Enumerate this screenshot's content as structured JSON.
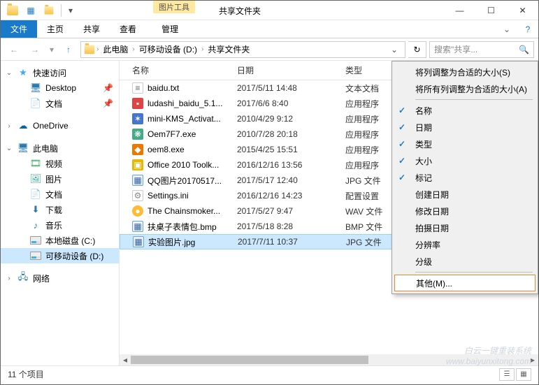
{
  "window": {
    "tool_context": "图片工具",
    "title": "共享文件夹",
    "min": "—",
    "max": "☐",
    "close": "✕"
  },
  "ribbon": {
    "file": "文件",
    "home": "主页",
    "share": "共享",
    "view": "查看",
    "manage": "管理"
  },
  "address": {
    "seg1": "此电脑",
    "seg2": "可移动设备 (D:)",
    "seg3": "共享文件夹",
    "search_placeholder": "搜索\"共享..."
  },
  "nav": {
    "quick": "快速访问",
    "desktop": "Desktop",
    "docs": "文档",
    "onedrive": "OneDrive",
    "thispc": "此电脑",
    "video": "视频",
    "pictures": "图片",
    "documents": "文档",
    "downloads": "下载",
    "music": "音乐",
    "localc": "本地磁盘 (C:)",
    "removable": "可移动设备 (D:)",
    "network": "网络"
  },
  "columns": {
    "name": "名称",
    "date": "日期",
    "type": "类型"
  },
  "files": [
    {
      "name": "baidu.txt",
      "date": "2017/5/11 14:48",
      "type": "文本文档",
      "icon": "txt"
    },
    {
      "name": "ludashi_baidu_5.1...",
      "date": "2017/6/6 8:40",
      "type": "应用程序",
      "icon": "exe"
    },
    {
      "name": "mini-KMS_Activat...",
      "date": "2010/4/29 9:12",
      "type": "应用程序",
      "icon": "exe2"
    },
    {
      "name": "Oem7F7.exe",
      "date": "2010/7/28 20:18",
      "type": "应用程序",
      "icon": "exe3"
    },
    {
      "name": "oem8.exe",
      "date": "2015/4/25 15:51",
      "type": "应用程序",
      "icon": "exe4"
    },
    {
      "name": "Office 2010 Toolk...",
      "date": "2016/12/16 13:56",
      "type": "应用程序",
      "icon": "exe5"
    },
    {
      "name": "QQ图片20170517...",
      "date": "2017/5/17 12:40",
      "type": "JPG 文件",
      "icon": "jpg"
    },
    {
      "name": "Settings.ini",
      "date": "2016/12/16 14:23",
      "type": "配置设置",
      "icon": "ini"
    },
    {
      "name": "The Chainsmoker...",
      "date": "2017/5/27 9:47",
      "type": "WAV 文件",
      "icon": "wav"
    },
    {
      "name": "扶桌子表情包.bmp",
      "date": "2017/5/18 8:28",
      "type": "BMP 文件",
      "icon": "bmp"
    },
    {
      "name": "实验图片.jpg",
      "date": "2017/7/11 10:37",
      "type": "JPG 文件",
      "icon": "jpg",
      "selected": true
    }
  ],
  "context_menu": {
    "size_to_fit": "将列调整为合适的大小(S)",
    "size_all_to_fit": "将所有列调整为合适的大小(A)",
    "name": "名称",
    "date": "日期",
    "type": "类型",
    "size": "大小",
    "tags": "标记",
    "date_created": "创建日期",
    "date_modified": "修改日期",
    "date_taken": "拍摄日期",
    "resolution": "分辨率",
    "rating": "分级",
    "other": "其他(M)..."
  },
  "status": {
    "items": "11 个项目"
  },
  "watermark": {
    "line1": "白云一键重装系统",
    "line2": "www.baiyunxitong.com"
  }
}
